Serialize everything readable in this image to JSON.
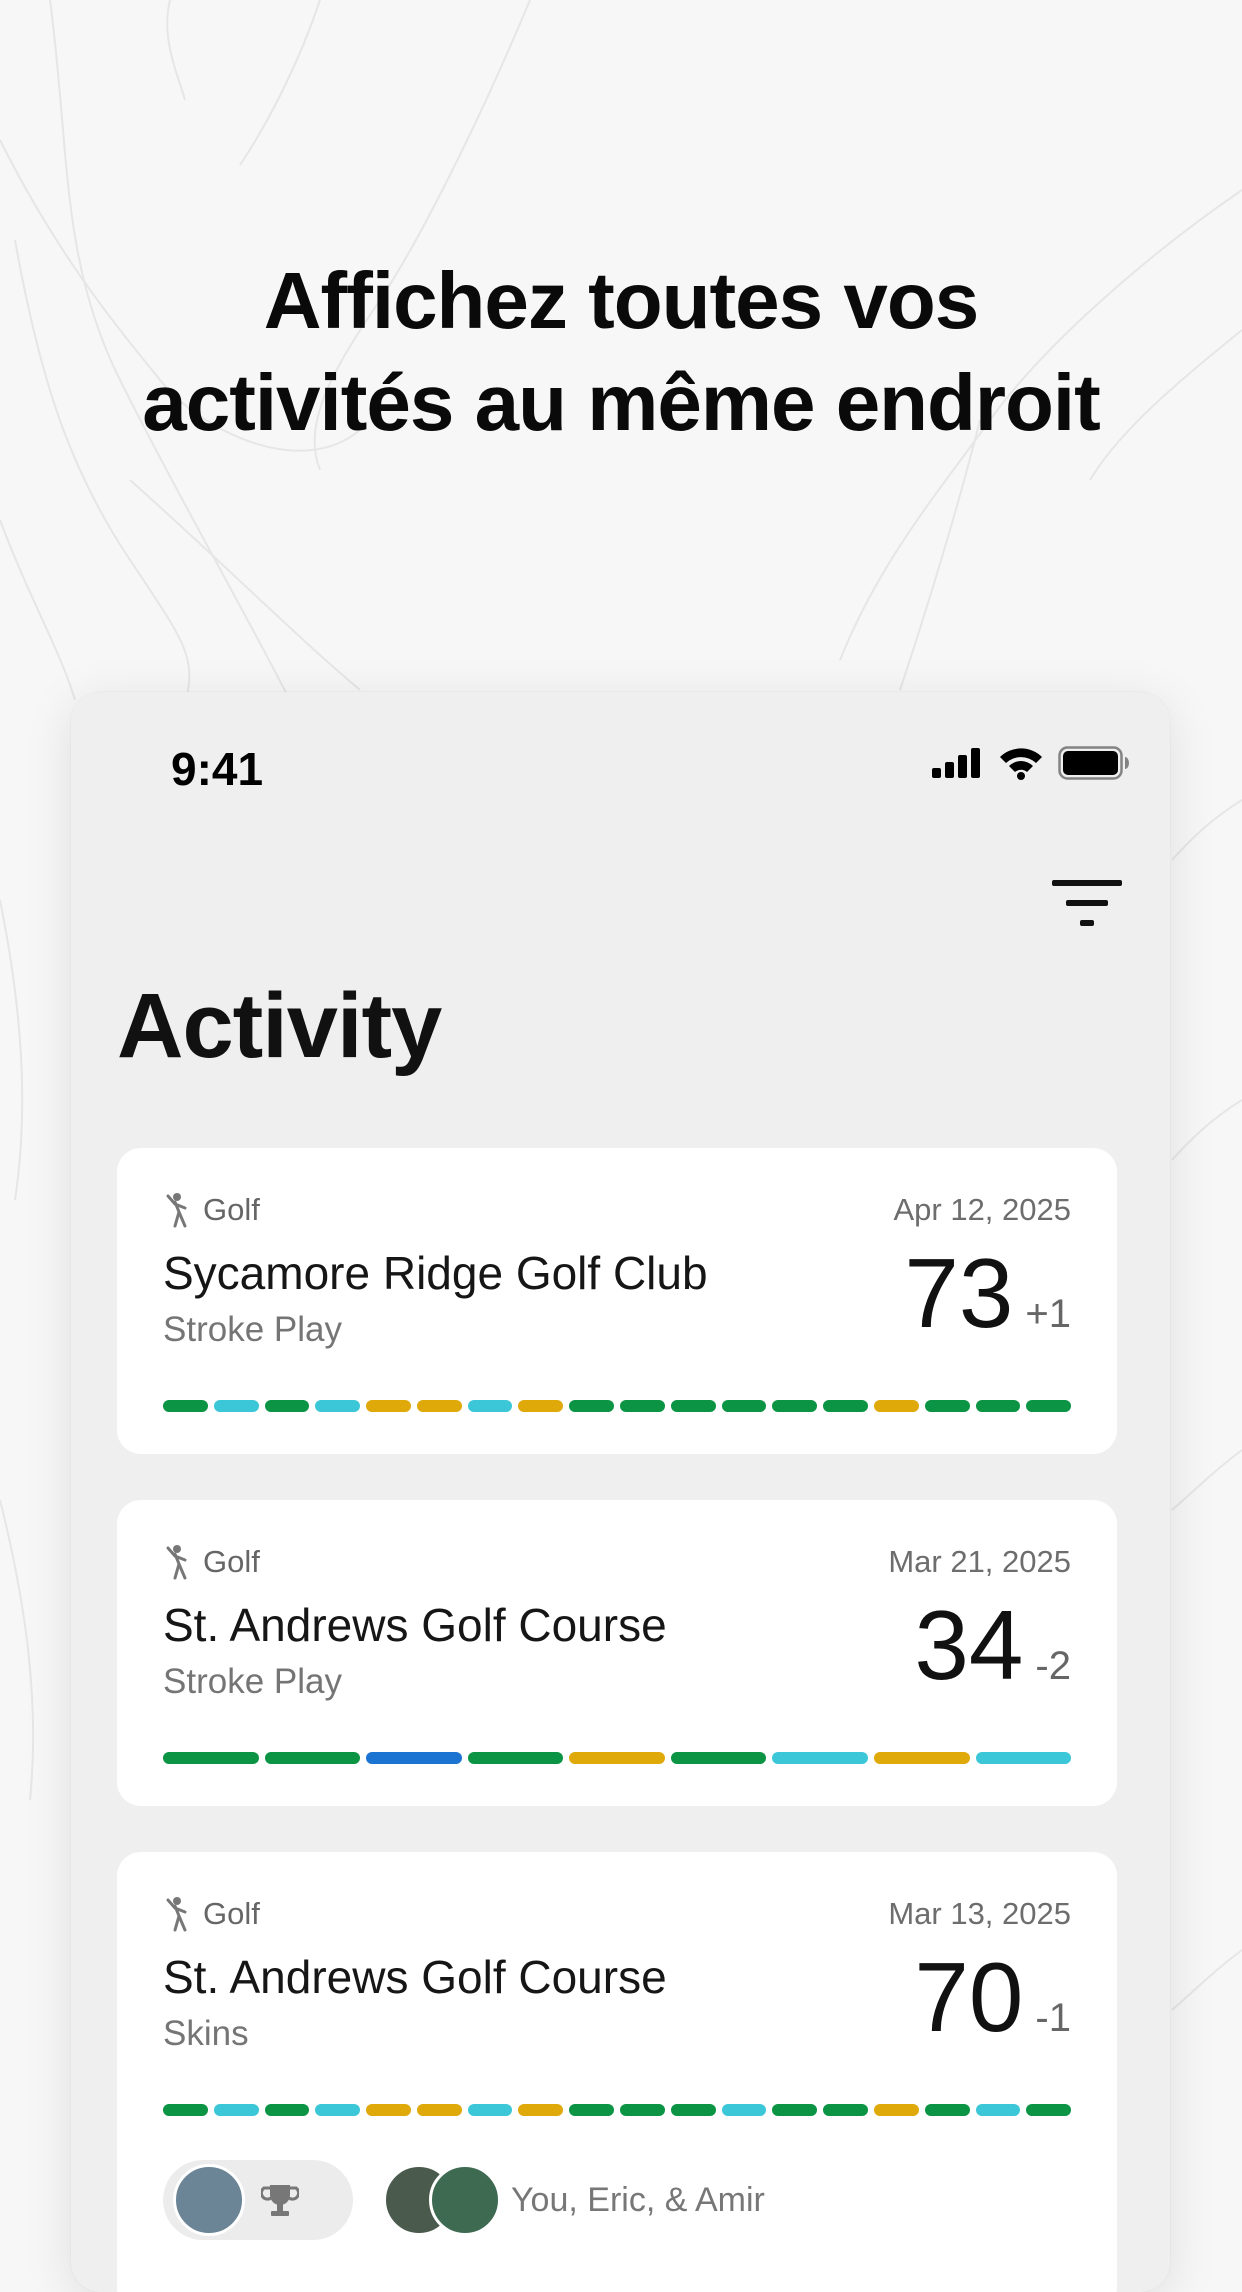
{
  "headline": {
    "line1": "Affichez toutes vos",
    "line2": "activités au même endroit"
  },
  "status_bar": {
    "time": "9:41"
  },
  "page": {
    "title": "Activity"
  },
  "colors": {
    "green": "#0a9443",
    "cyan": "#3cc7d8",
    "yellow": "#e0a90a",
    "blue": "#1b74d1"
  },
  "cards": [
    {
      "sport": "Golf",
      "date": "Apr 12, 2025",
      "course": "Sycamore Ridge Golf Club",
      "format": "Stroke Play",
      "score": "73",
      "diff": "+1",
      "holes": [
        "green",
        "cyan",
        "green",
        "cyan",
        "yellow",
        "yellow",
        "cyan",
        "yellow",
        "green",
        "green",
        "green",
        "green",
        "green",
        "green",
        "yellow",
        "green",
        "green",
        "green"
      ]
    },
    {
      "sport": "Golf",
      "date": "Mar 21, 2025",
      "course": "St. Andrews Golf Course",
      "format": "Stroke Play",
      "score": "34",
      "diff": "-2",
      "holes": [
        "green",
        "green",
        "blue",
        "green",
        "yellow",
        "green",
        "cyan",
        "yellow",
        "cyan"
      ]
    },
    {
      "sport": "Golf",
      "date": "Mar 13, 2025",
      "course": "St. Andrews Golf Course",
      "format": "Skins",
      "score": "70",
      "diff": "-1",
      "holes": [
        "green",
        "cyan",
        "green",
        "cyan",
        "yellow",
        "yellow",
        "cyan",
        "yellow",
        "green",
        "green",
        "green",
        "cyan",
        "green",
        "green",
        "yellow",
        "green",
        "cyan",
        "green"
      ],
      "players": "You, Eric, & Amir"
    }
  ]
}
